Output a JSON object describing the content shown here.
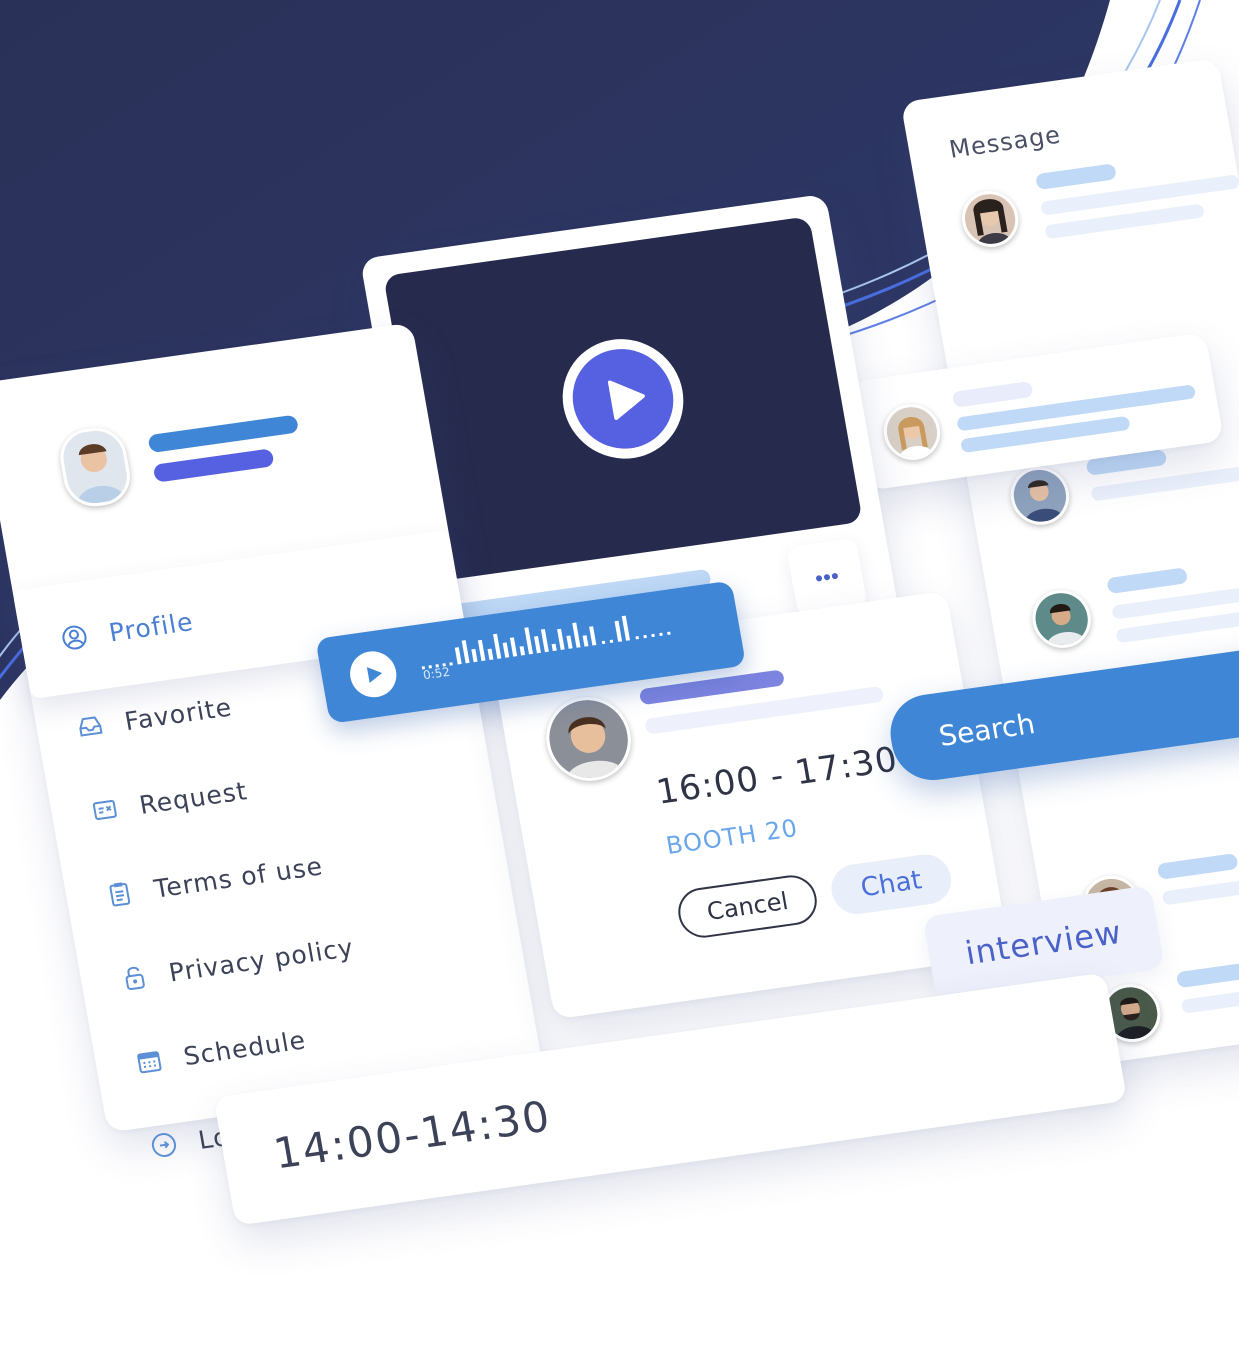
{
  "menu": {
    "items": [
      {
        "label": "Profile",
        "icon": "user-circle-icon",
        "active": true
      },
      {
        "label": "Favorite",
        "icon": "inbox-icon",
        "active": false
      },
      {
        "label": "Request",
        "icon": "request-icon",
        "active": false
      },
      {
        "label": "Terms of use",
        "icon": "clipboard-icon",
        "active": false
      },
      {
        "label": "Privacy policy",
        "icon": "lock-icon",
        "active": false
      },
      {
        "label": "Schedule",
        "icon": "calendar-icon",
        "active": false
      },
      {
        "label": "Log out",
        "icon": "logout-icon",
        "active": false
      }
    ]
  },
  "audio": {
    "duration": "0:52"
  },
  "booking": {
    "time": "16:00 - 17:30",
    "booth": "BOOTH 20",
    "cancel_label": "Cancel",
    "chat_label": "Chat"
  },
  "search": {
    "label": "Search"
  },
  "tag": {
    "label": "interview"
  },
  "messages": {
    "title": "Message"
  },
  "bottom": {
    "time": "14:00-14:30"
  },
  "colors": {
    "navy": "#2d3561",
    "accent_blue": "#3f87d6",
    "accent_indigo": "#5561e0",
    "light_blue": "#bfd9f6"
  }
}
